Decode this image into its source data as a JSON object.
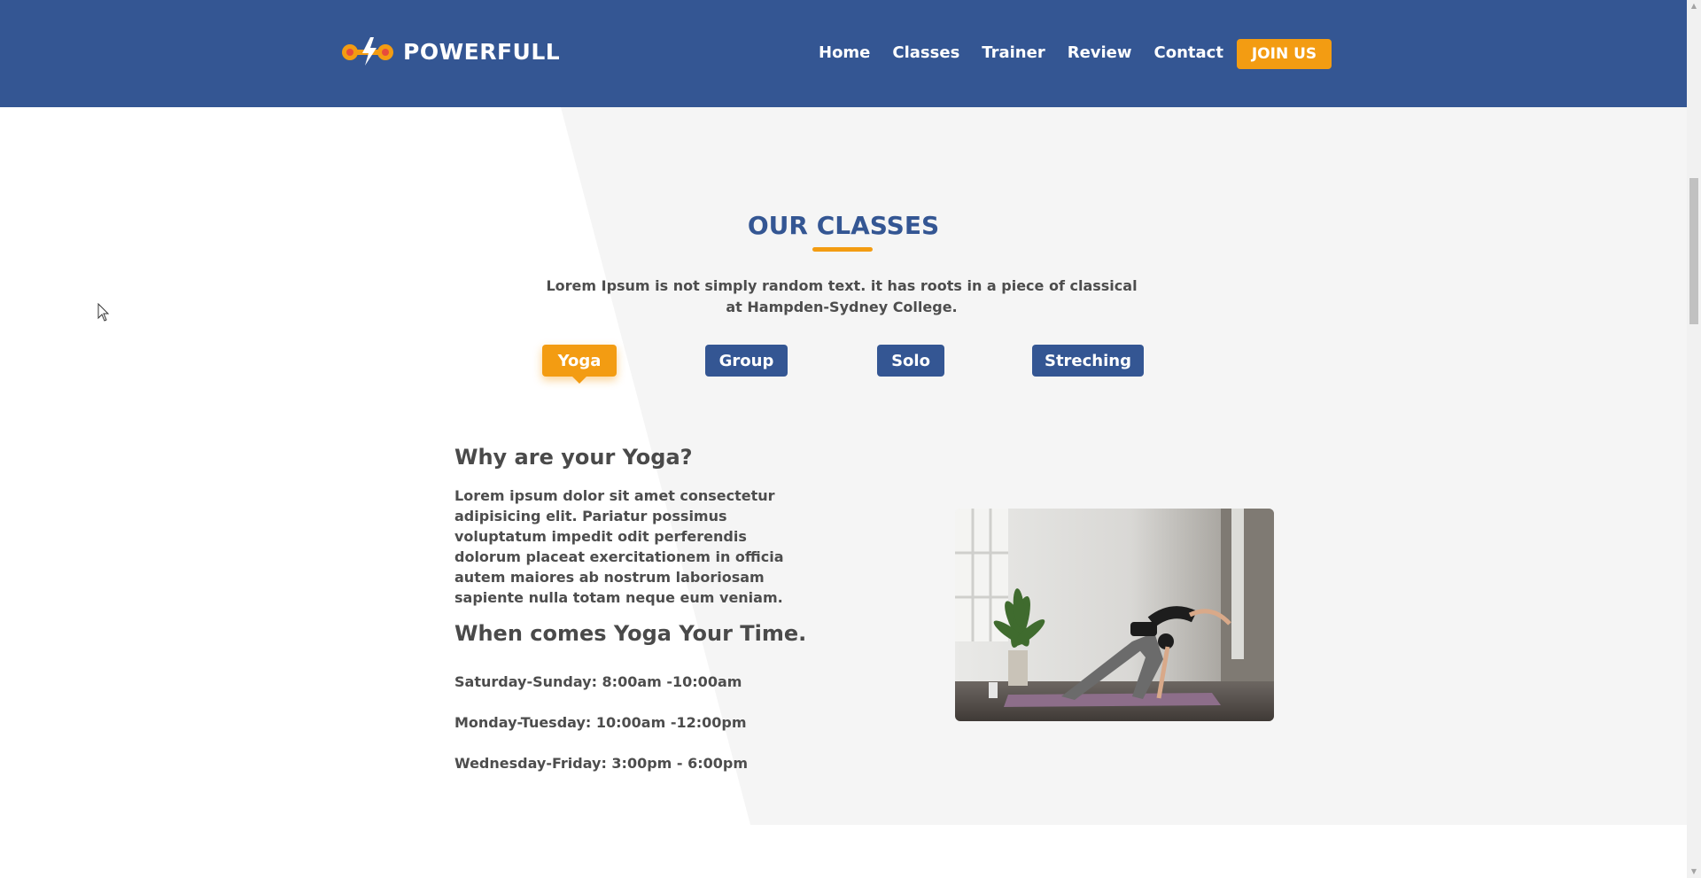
{
  "header": {
    "brand_name": "POWERFULL",
    "nav": [
      "Home",
      "Classes",
      "Trainer",
      "Review",
      "Contact"
    ],
    "join_label": "JOIN US"
  },
  "classes": {
    "title": "OUR CLASSES",
    "intro": "Lorem Ipsum is not simply random text. it has roots in a piece of classical at Hampden-Sydney College.",
    "tabs": [
      "Yoga",
      "Group",
      "Solo",
      "Streching"
    ],
    "active_tab": "Yoga"
  },
  "content": {
    "heading": "Why are your Yoga?",
    "body": "Lorem ipsum dolor sit amet consectetur adipisicing elit. Pariatur possimus voluptatum impedit odit perferendis dolorum placeat exercitationem in officia autem maiores ab nostrum laboriosam sapiente nulla totam neque eum veniam.",
    "schedule_heading": "When comes Yoga Your Time.",
    "schedule": [
      "Saturday-Sunday: 8:00am -10:00am",
      "Monday-Tuesday: 10:00am -12:00pm",
      "Wednesday-Friday: 3:00pm - 6:00pm"
    ]
  },
  "colors": {
    "primary": "#345693",
    "accent": "#f39c12",
    "section_background": "#f5f5f5"
  },
  "icons": {
    "brand": "dumbbell-lightning-logo",
    "cursor": "mouse-pointer-icon"
  }
}
